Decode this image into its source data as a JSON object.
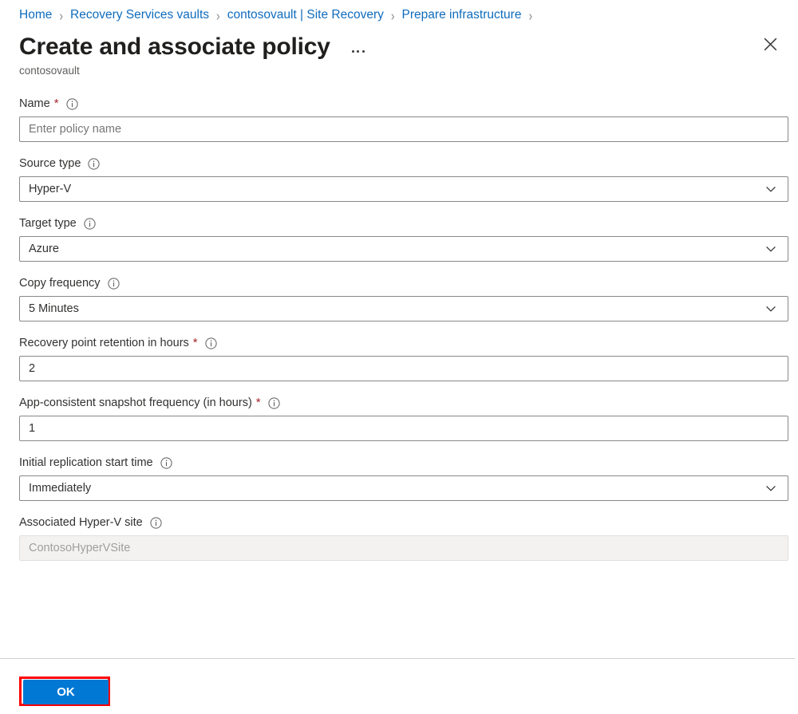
{
  "breadcrumb": {
    "items": [
      {
        "label": "Home"
      },
      {
        "label": "Recovery Services vaults"
      },
      {
        "label": "contosovault | Site Recovery"
      },
      {
        "label": "Prepare infrastructure"
      }
    ],
    "separator": "›"
  },
  "header": {
    "title": "Create and associate policy",
    "subtitle": "contosovault",
    "more_label": "More commands",
    "close_label": "Close"
  },
  "form": {
    "fields": [
      {
        "label": "Name",
        "required": true,
        "type": "text",
        "value": "",
        "placeholder": "Enter policy name",
        "name": "name"
      },
      {
        "label": "Source type",
        "required": false,
        "type": "select",
        "value": "Hyper-V",
        "name": "source-type"
      },
      {
        "label": "Target type",
        "required": false,
        "type": "select",
        "value": "Azure",
        "name": "target-type"
      },
      {
        "label": "Copy frequency",
        "required": false,
        "type": "select",
        "value": "5 Minutes",
        "name": "copy-frequency"
      },
      {
        "label": "Recovery point retention in hours",
        "required": true,
        "type": "text",
        "value": "2",
        "placeholder": "",
        "name": "recovery-point-retention"
      },
      {
        "label": "App-consistent snapshot frequency (in hours)",
        "required": true,
        "type": "text",
        "value": "1",
        "placeholder": "",
        "name": "app-consistent-snapshot-frequency"
      },
      {
        "label": "Initial replication start time",
        "required": false,
        "type": "select",
        "value": "Immediately",
        "name": "initial-replication-start-time"
      },
      {
        "label": "Associated Hyper-V site",
        "required": false,
        "type": "disabled",
        "value": "ContosoHyperVSite",
        "name": "associated-hyper-v-site"
      }
    ],
    "required_marker": "*",
    "info_tooltip": "More information"
  },
  "footer": {
    "ok_label": "OK"
  },
  "colors": {
    "link": "#0f6cbd",
    "primary_button": "#0078d4",
    "required_star": "#a4262c",
    "highlight_box": "#ff0000",
    "border": "#8a8886",
    "disabled_bg": "#f3f2f1"
  }
}
